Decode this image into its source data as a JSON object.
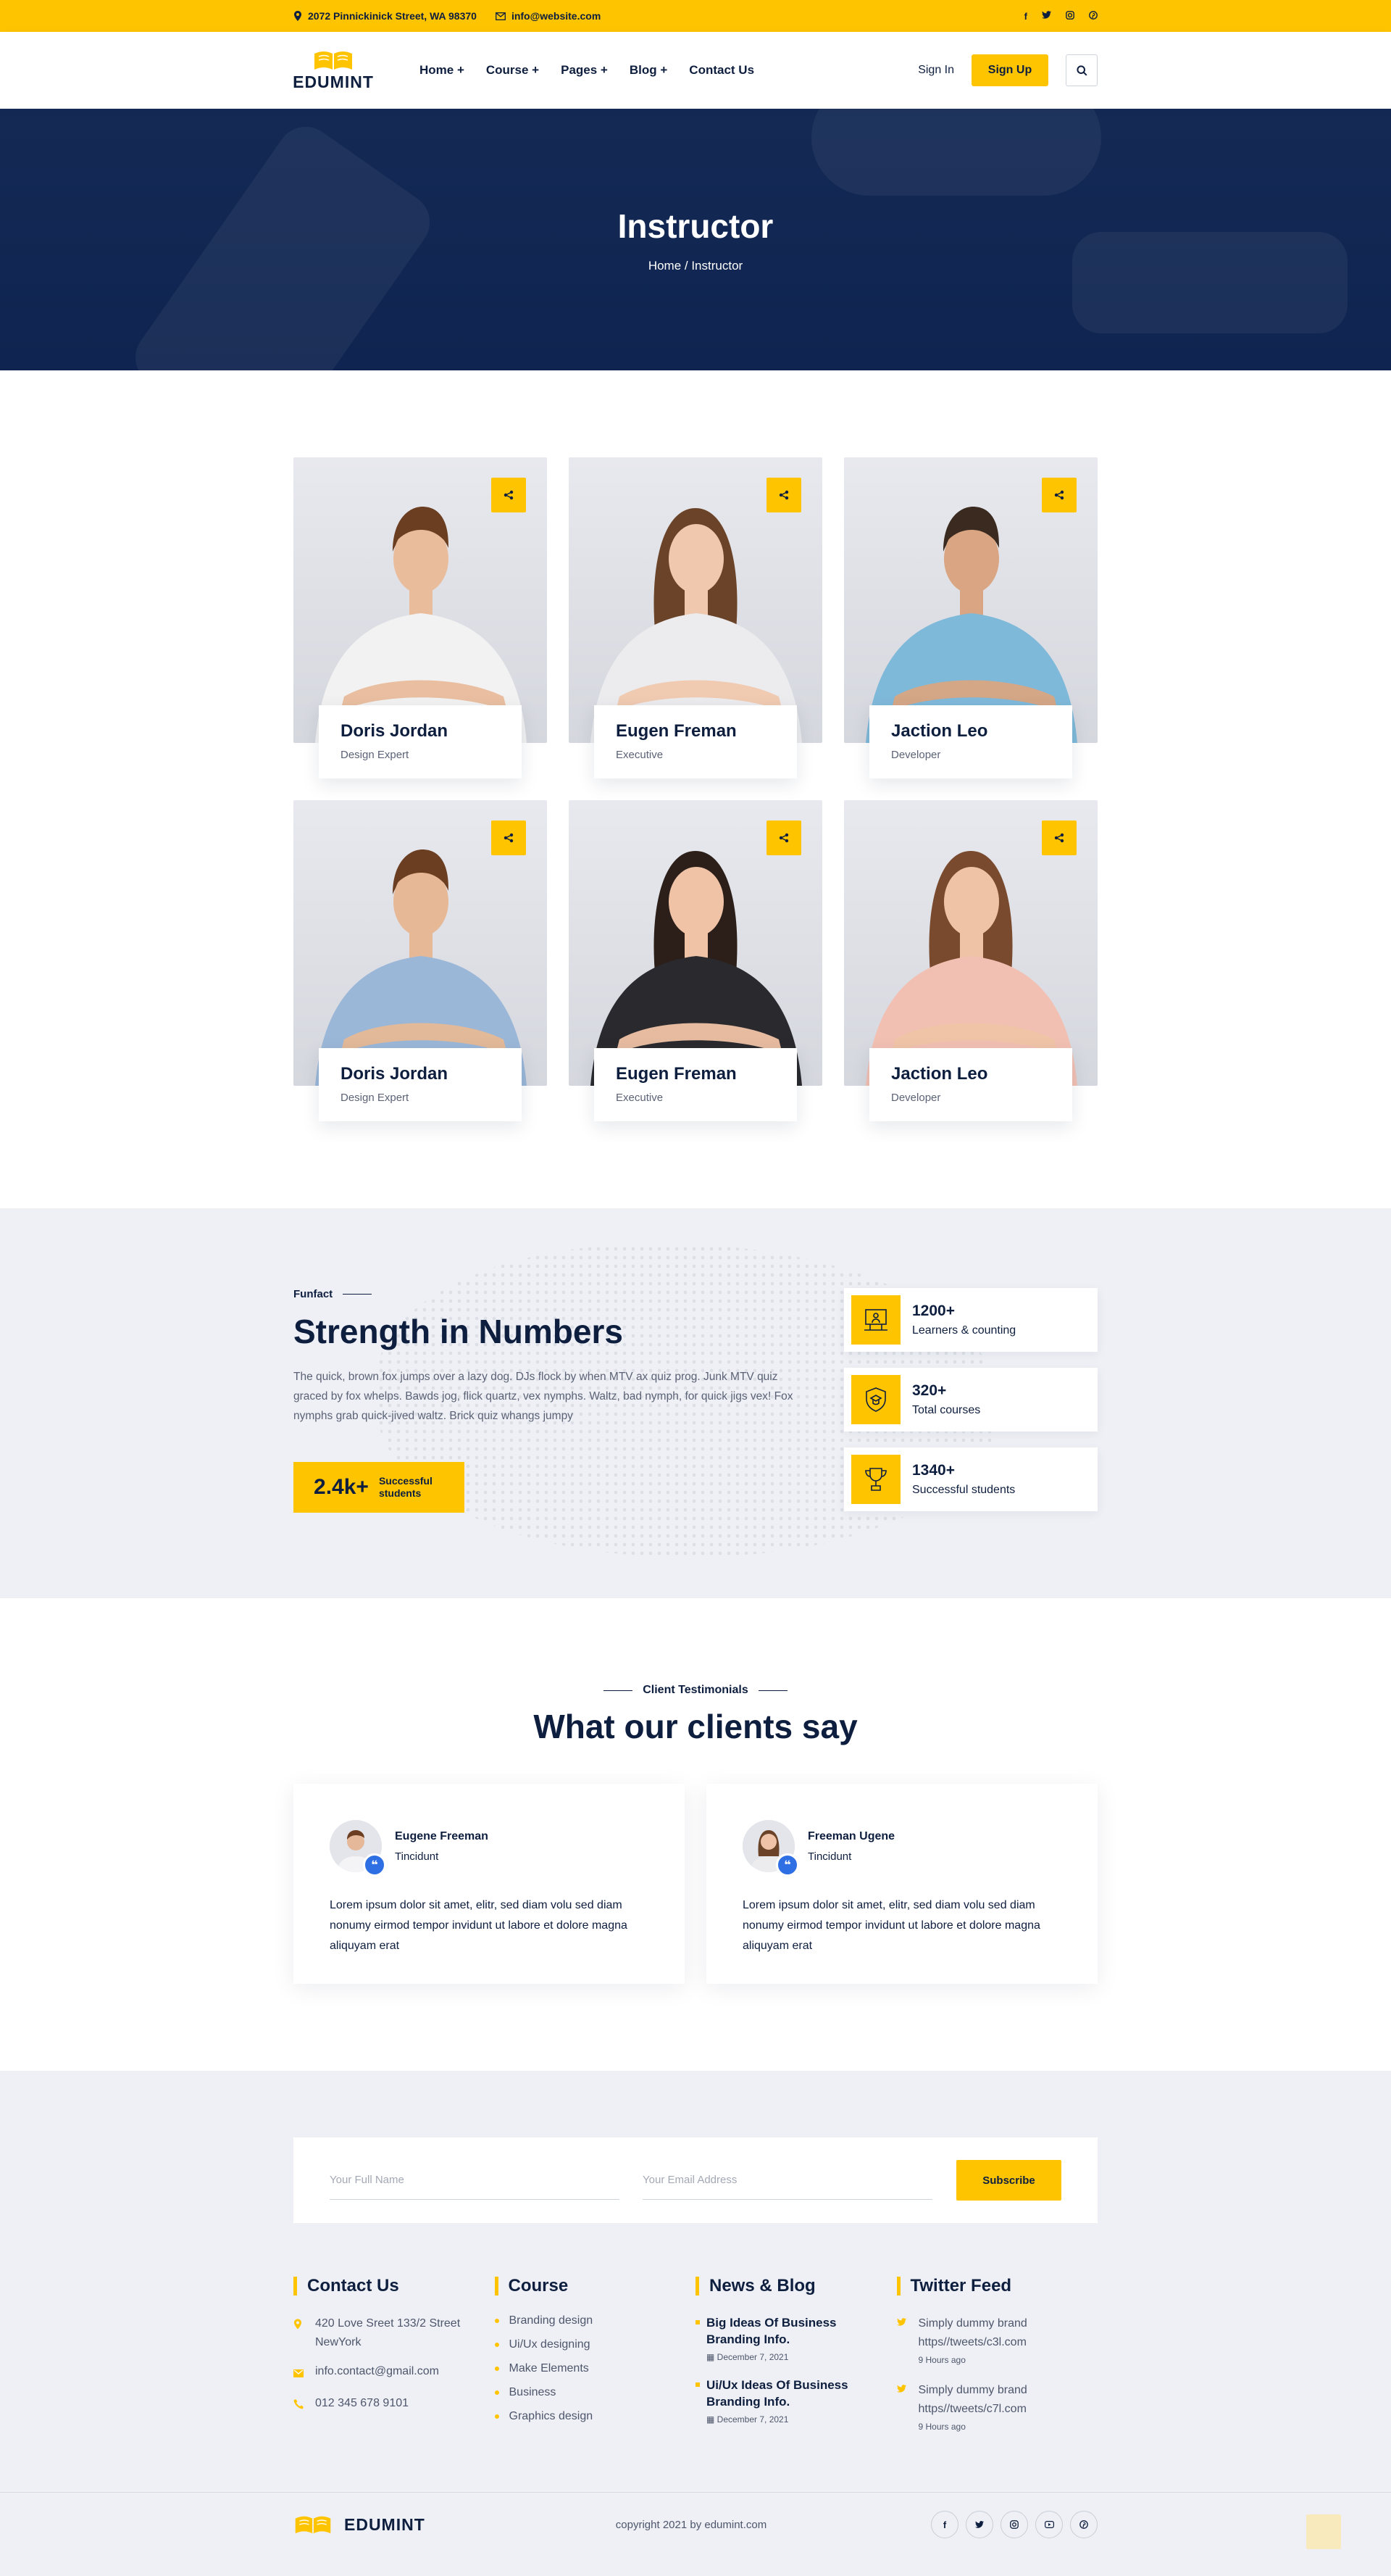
{
  "topbar": {
    "address": "2072 Pinnickinick Street, WA 98370",
    "email": "info@website.com",
    "social": [
      "f",
      "t",
      "ig",
      "p"
    ]
  },
  "header": {
    "logo": "EDUMINT",
    "nav": [
      "Home +",
      "Course +",
      "Pages +",
      "Blog +",
      "Contact Us"
    ],
    "signin": "Sign In",
    "signup": "Sign Up"
  },
  "hero": {
    "title": "Instructor",
    "breadcrumb": "Home / Instructor"
  },
  "instructors": [
    {
      "name": "Doris Jordan",
      "role": "Design Expert",
      "shirt": "#f2f2f2",
      "hair": "#6b3e22"
    },
    {
      "name": "Eugen Freman",
      "role": "Executive",
      "shirt": "#ececee",
      "hair": "#6a4328"
    },
    {
      "name": "Jaction Leo",
      "role": "Developer",
      "shirt": "#7fb9d9",
      "hair": "#3a2a20"
    },
    {
      "name": "Doris Jordan",
      "role": "Design Expert",
      "shirt": "#9bb7d8",
      "hair": "#6b3e22"
    },
    {
      "name": "Eugen Freman",
      "role": "Executive",
      "shirt": "#2a2a2e",
      "hair": "#2c1f1a"
    },
    {
      "name": "Jaction Leo",
      "role": "Developer",
      "shirt": "#f2c0b3",
      "hair": "#7a4a2e"
    }
  ],
  "funfact": {
    "tag": "Funfact",
    "title": "Strength in Numbers",
    "text": "The quick, brown fox jumps over a lazy dog. DJs flock by when MTV ax quiz prog. Junk MTV quiz graced by fox whelps. Bawds jog, flick quartz, vex nymphs. Waltz, bad nymph, for quick jigs vex! Fox nymphs grab quick-jived waltz. Brick quiz whangs jumpy",
    "badge_value": "2.4k+",
    "badge_label": "Successful students",
    "stats": [
      {
        "value": "1200+",
        "label": "Learners & counting",
        "icon": "classroom-icon"
      },
      {
        "value": "320+",
        "label": "Total courses",
        "icon": "shield-icon"
      },
      {
        "value": "1340+",
        "label": "Successful students",
        "icon": "trophy-icon"
      }
    ]
  },
  "testimonials": {
    "tag": "Client Testimonials",
    "title": "What our clients say",
    "items": [
      {
        "name": "Eugene Freeman",
        "role": "Tincidunt",
        "text": "Lorem ipsum dolor sit amet, elitr, sed diam volu sed diam nonumy eirmod tempor invidunt ut labore et dolore magna aliquyam erat"
      },
      {
        "name": "Freeman Ugene",
        "role": "Tincidunt",
        "text": "Lorem ipsum dolor sit amet, elitr, sed diam volu sed diam nonumy eirmod tempor invidunt ut labore et dolore magna aliquyam erat"
      }
    ]
  },
  "subscribe": {
    "name_placeholder": "Your Full Name",
    "email_placeholder": "Your Email Address",
    "button": "Subscribe"
  },
  "footer": {
    "contact_title": "Contact Us",
    "contact": [
      {
        "icon": "map-pin-icon",
        "text": "420 Love Sreet 133/2 Street NewYork"
      },
      {
        "icon": "mail-icon",
        "text": "info.contact@gmail.com"
      },
      {
        "icon": "phone-icon",
        "text": "012 345 678 9101"
      }
    ],
    "course_title": "Course",
    "courses": [
      "Branding design",
      "Ui/Ux designing",
      "Make Elements",
      "Business",
      "Graphics design"
    ],
    "news_title": "News & Blog",
    "news": [
      {
        "title": "Big Ideas Of Business Branding Info.",
        "date": "December 7, 2021"
      },
      {
        "title": "Ui/Ux Ideas Of Business Branding Info.",
        "date": "December 7, 2021"
      }
    ],
    "twitter_title": "Twitter Feed",
    "tweets": [
      {
        "text": "Simply dummy brand https//tweets/c3l.com",
        "time": "9 Hours ago"
      },
      {
        "text": "Simply dummy brand https//tweets/c7l.com",
        "time": "9 Hours ago"
      }
    ],
    "logo": "EDUMINT",
    "copyright": "copyright 2021 by edumint.com",
    "social": [
      "f",
      "t",
      "ig",
      "yt",
      "p"
    ]
  },
  "colors": {
    "accent": "#ffc400",
    "navy": "#0e1e3e",
    "hero": "#142a55"
  }
}
